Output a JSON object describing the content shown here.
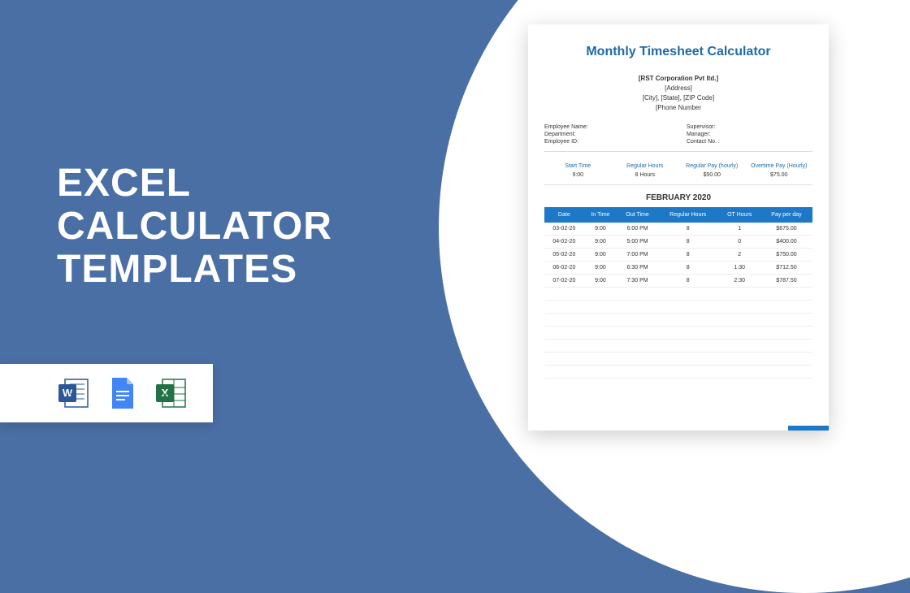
{
  "hero": {
    "line1": "EXCEL",
    "line2": "CALCULATOR",
    "line3": "TEMPLATES"
  },
  "icons": {
    "word": "word-icon",
    "docs": "google-docs-icon",
    "excel": "excel-icon"
  },
  "doc": {
    "title": "Monthly Timesheet Calculator",
    "company": {
      "name": "[RST Corporation Pvt ltd.]",
      "address": "[Address]",
      "city_state_zip": "[City], [State], [ZIP Code]",
      "phone": "[Phone Number"
    },
    "fields": {
      "emp_name_label": "Employee Name:",
      "supervisor_label": "Supervisor:",
      "department_label": "Department:",
      "manager_label": "Manager:",
      "emp_id_label": "Employee ID:",
      "contact_label": "Contact No. :"
    },
    "rates": {
      "start_time_label": "Start Time",
      "regular_hours_label": "Regular Hours",
      "regular_pay_label": "Regular Pay (hourly)",
      "overtime_pay_label": "Overtime Pay (Hourly)",
      "start_time": "9:00",
      "regular_hours": "8 Hours",
      "regular_pay": "$50.00",
      "overtime_pay": "$75.00"
    },
    "month": "FEBRUARY 2020",
    "table": {
      "headers": [
        "Date",
        "In Time",
        "Out Time",
        "Regular Hours",
        "OT Hours",
        "Pay per day"
      ],
      "rows": [
        [
          "03-02-20",
          "9:00",
          "6:00 PM",
          "8",
          "1",
          "$675.00"
        ],
        [
          "04-02-20",
          "9:00",
          "5:00 PM",
          "8",
          "0",
          "$400.00"
        ],
        [
          "05-02-20",
          "9:00",
          "7:00 PM",
          "8",
          "2",
          "$750.00"
        ],
        [
          "06-02-20",
          "9:00",
          "6:30 PM",
          "8",
          "1:30",
          "$712.50"
        ],
        [
          "07-02-20",
          "9:00",
          "7:30 PM",
          "8",
          "2:30",
          "$787.50"
        ]
      ]
    }
  }
}
